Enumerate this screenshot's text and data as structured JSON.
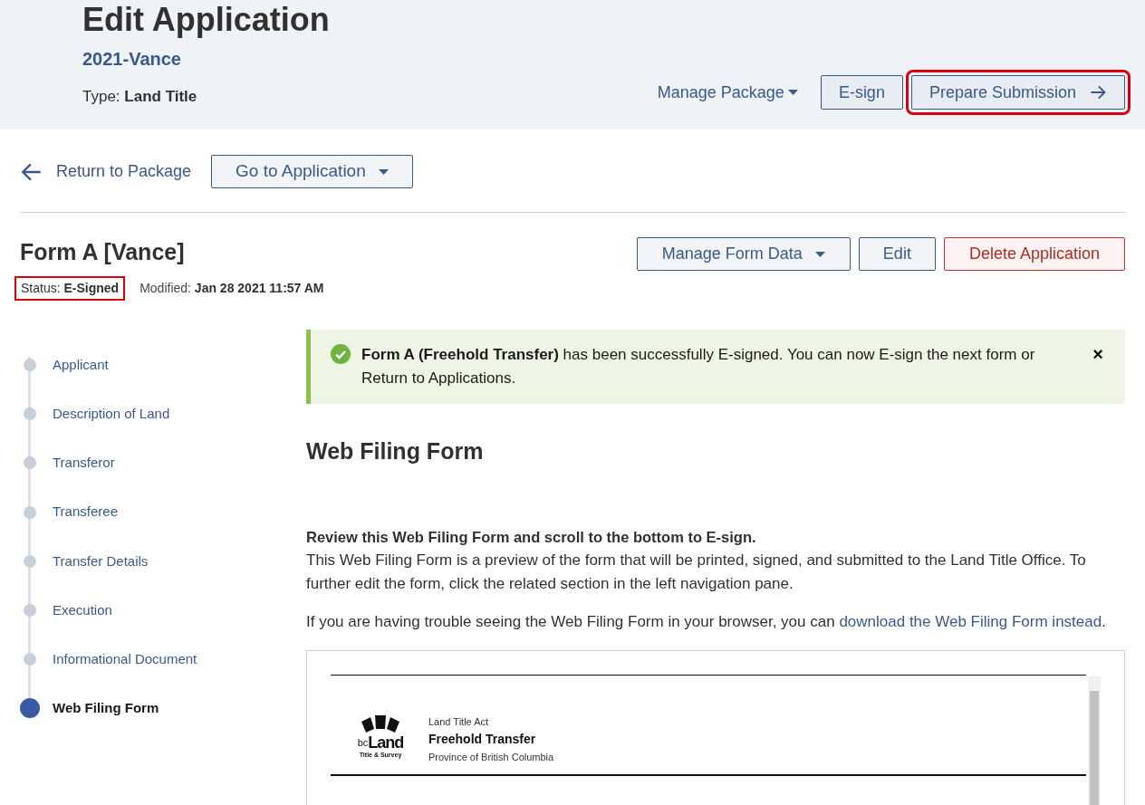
{
  "header": {
    "title": "Edit Application",
    "package": "2021-Vance",
    "type_label": "Type:",
    "type_value": "Land Title",
    "actions": [
      {
        "kind": "menu",
        "label": "Manage Package",
        "highlighted": false
      },
      {
        "kind": "button",
        "label": "E-sign",
        "highlighted": false
      },
      {
        "kind": "forward",
        "label": "Prepare Submission",
        "highlighted": true
      }
    ]
  },
  "nav": {
    "back_link": "Return to Package",
    "dropdown": "Go to Application"
  },
  "form": {
    "title": "Form A [Vance]",
    "status_label": "Status:",
    "status_value": "E-Signed",
    "status_highlighted": true,
    "modified_label": "Modified:",
    "modified_value": "Jan 28 2021 11:57 AM",
    "actions": [
      {
        "kind": "menu",
        "label": "Manage Form Data"
      },
      {
        "kind": "button",
        "label": "Edit"
      },
      {
        "kind": "danger",
        "label": "Delete Application"
      }
    ]
  },
  "steps": [
    {
      "label": "Applicant",
      "selected": false
    },
    {
      "label": "Description of Land",
      "selected": false
    },
    {
      "label": "Transferor",
      "selected": false
    },
    {
      "label": "Transferee",
      "selected": false
    },
    {
      "label": "Transfer Details",
      "selected": false
    },
    {
      "label": "Execution",
      "selected": false
    },
    {
      "label": "Informational Document",
      "selected": false
    },
    {
      "label": "Web Filing Form",
      "selected": true
    }
  ],
  "alert": {
    "message": "**Form A (Freehold Transfer)** has been successfully E-signed. You can now E-sign the next form or Return to Applications.",
    "close": "×"
  },
  "content": {
    "heading": "Web Filing Form",
    "instruction": "Review this Web Filing Form and scroll to the bottom to E-sign.",
    "paragraph": "This Web Filing Form is a preview of the form that will be printed, signed, and submitted to the Land Title Office. To further edit the form, click the related section in the left navigation pane.",
    "trouble_text": "If you are having trouble seeing the Web Filing Form in your browser, you can",
    "download_link": "download the Web Filing Form instead",
    "trailing": "."
  },
  "preview": {
    "logo_main": "bc",
    "logo_land": "Land",
    "logo_sub": "Title & Survey",
    "act": "Land Title Act",
    "form_name": "Freehold Transfer",
    "province": "Province of British Columbia"
  }
}
